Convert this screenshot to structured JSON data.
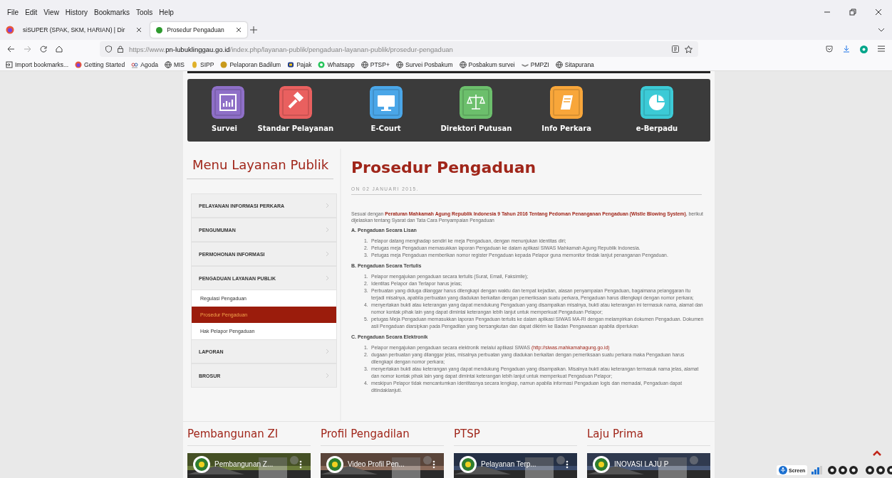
{
  "browser": {
    "menu": [
      "File",
      "Edit",
      "View",
      "History",
      "Bookmarks",
      "Tools",
      "Help"
    ],
    "tabs": [
      {
        "title": "siSUPER (SPAK, SKM, HARIAN) | Dir",
        "selected": false
      },
      {
        "title": "Prosedur Pengaduan",
        "selected": true
      }
    ],
    "url": {
      "prefix": "https://www.",
      "host": "pn-lubuklinggau.go.id",
      "path": "/index.php/layanan-publik/pengaduan-layanan-publik/prosedur-pengaduan"
    },
    "bookmarks": [
      {
        "label": "Import bookmarks...",
        "kind": "import"
      },
      {
        "label": "Getting Started",
        "kind": "firefox"
      },
      {
        "label": "Agoda",
        "kind": "agoda"
      },
      {
        "label": "MIS",
        "kind": "globe"
      },
      {
        "label": "SIPP",
        "kind": "sipp"
      },
      {
        "label": "Pelaporan Badilum",
        "kind": "coin"
      },
      {
        "label": "Pajak",
        "kind": "pajak"
      },
      {
        "label": "Whatsapp",
        "kind": "whatsapp"
      },
      {
        "label": "PTSP+",
        "kind": "globe"
      },
      {
        "label": "Survei Posbakum",
        "kind": "globe"
      },
      {
        "label": "Posbakum survei",
        "kind": "globe"
      },
      {
        "label": "PMPZI",
        "kind": "book"
      },
      {
        "label": "Sitapurana",
        "kind": "globe"
      }
    ]
  },
  "services": [
    {
      "label": "Survei",
      "color": "#8e6fc7"
    },
    {
      "label": "Standar Pelayanan",
      "color": "#e9605f"
    },
    {
      "label": "E-Court",
      "color": "#4aa6e8"
    },
    {
      "label": "Direktori Putusan",
      "color": "#6cbf6c"
    },
    {
      "label": "Info Perkara",
      "color": "#f8a63a"
    },
    {
      "label": "e-Berpadu",
      "color": "#3ccad6"
    }
  ],
  "sidebar": {
    "title": "Menu Layanan Publik",
    "items": [
      {
        "label": "PELAYANAN INFORMASI PERKARA",
        "selected": false
      },
      {
        "label": "PENGUMUMAN",
        "selected": false
      },
      {
        "label": "PERMOHONAN INFORMASI",
        "selected": false
      },
      {
        "label": "PENGADUAN LAYANAN PUBLIK",
        "selected": false,
        "children": [
          {
            "label": "Regulasi Pengaduan",
            "selected": false
          },
          {
            "label": "Prosedur Pengaduan",
            "selected": true
          },
          {
            "label": "Hak Pelapor Pengaduan",
            "selected": false
          }
        ]
      },
      {
        "label": "LAPORAN",
        "selected": false
      },
      {
        "label": "BROSUR",
        "selected": false
      }
    ]
  },
  "article": {
    "title": "Prosedur Pengaduan",
    "date": "ON 02 JANUARI 2015.",
    "intro": "Sesuai dengan **Peraturan Mahkamah Agung Republik Indonesia 9 Tahun 2016 Tentang Pedoman Penanganan Pengaduan (Wistle Blowing System)**, berikut dijelaskan tentang Syarat dan Tata Cara Penyampaian Pengaduan",
    "sections": [
      {
        "heading": "A. Pengaduan Secara Lisan",
        "items": [
          {
            "number": "1.",
            "text": "Pelapor datang menghadap sendiri ke meja Pengaduan, dengan menunjukan identitas diri;"
          },
          {
            "number": "2.",
            "text": "Petugas meja Pengaduan memasukkan laporan Pengaduan ke dalam aplikasi SIWAS Mahkamah Agung Republik Indonesia."
          },
          {
            "number": "3.",
            "text": "Petugas meja Pengaduan memberikan nomor register Pengaduan kepada Pelapor guna memonitor tindak lanjut penanganan Pengaduan."
          }
        ]
      },
      {
        "heading": "B. Pengaduan Secara Tertulis",
        "items": [
          {
            "number": "1.",
            "text": "Pelapor mengajukan pengaduan secara tertulis (Surat, Email, Faksimile);"
          },
          {
            "number": "2.",
            "text": "Identitas Pelapor dan Terlapor harus jelas;"
          },
          {
            "number": "3.",
            "text": "Perbuatan yang diduga dilanggar harus dilengkapi dengan waktu dan tempat kejadian, alasan penyampaian Pengaduan, bagaimana pelanggaran itu terjadi  misalnya, apabila perbuatan yang diadukan berkaitan dengan pemeriksaan suatu perkara, Pengaduan harus dilengkapi dengan nomor perkara;"
          },
          {
            "number": "4.",
            "text": "menyertakan bukti atau keterangan yang dapat mendukung Pengaduan yang disampaikan misalnya, bukti atau keterangan ini termasuk nama, alamat dan nomor kontak pihak lain yang dapat dimintai keterangan lebih lanjut untuk memperkuat Pengaduan Pelapor;"
          },
          {
            "number": "5.",
            "text": "petugas Meja Pengaduan memasukkan laporan Pengaduan tertulis ke dalam aplikasi SIWAS MA-RI dengan melampirkan dokumen  Pengaduan. Dokumen asli Pengaduan diarsipkan pada Pengadilan yang bersangkutan dan dapat dikirim ke Badan Pengawasan apabila diperlukan"
          }
        ]
      },
      {
        "heading": "C. Pengaduan Secara Elektronik",
        "items": [
          {
            "number": "1.",
            "text": "Pelapor mengajukan pengaduan secara elektronik melalui aplikasi SIWAS **(http://siwas.mahkamahagung.go.id)**"
          },
          {
            "number": "2.",
            "text": "dugaan perbuatan yang dilanggar  jelas, misalnya perbuatan yang diadukan berkaitan dengan pemeriksaan suatu perkara maka Pengaduan harus dilengkapi dengan nomor perkara;"
          },
          {
            "number": "3.",
            "text": "menyertakan bukti atau keterangan yang dapat mendukung Pengaduan yang disampaikan. Misalnya bukti atau keterangan termasuk nama jelas, alamat dan nomor kontak pihak lain yang dapat dimintai keterangan lebih lanjut untuk memperkuat Pengaduan Pelapor;"
          },
          {
            "number": "4.",
            "text": "meskipun Pelapor tidak mencantumkan identitasnya secara lengkap, namun apabila informasi Pengaduan logis dan memadai, Pengaduan dapat ditindaklanjuti."
          }
        ]
      }
    ]
  },
  "widgets": [
    {
      "title": "Pembangunan ZI",
      "video": "Pembangunan Z..."
    },
    {
      "title": "Profil Pengadilan",
      "video": "Video Profil Pen..."
    },
    {
      "title": "PTSP",
      "video": "Pelayanan Terp..."
    },
    {
      "title": "Laju Prima",
      "video": "INOVASI LAJU P"
    }
  ],
  "accessibility": {
    "label": "Screen"
  }
}
